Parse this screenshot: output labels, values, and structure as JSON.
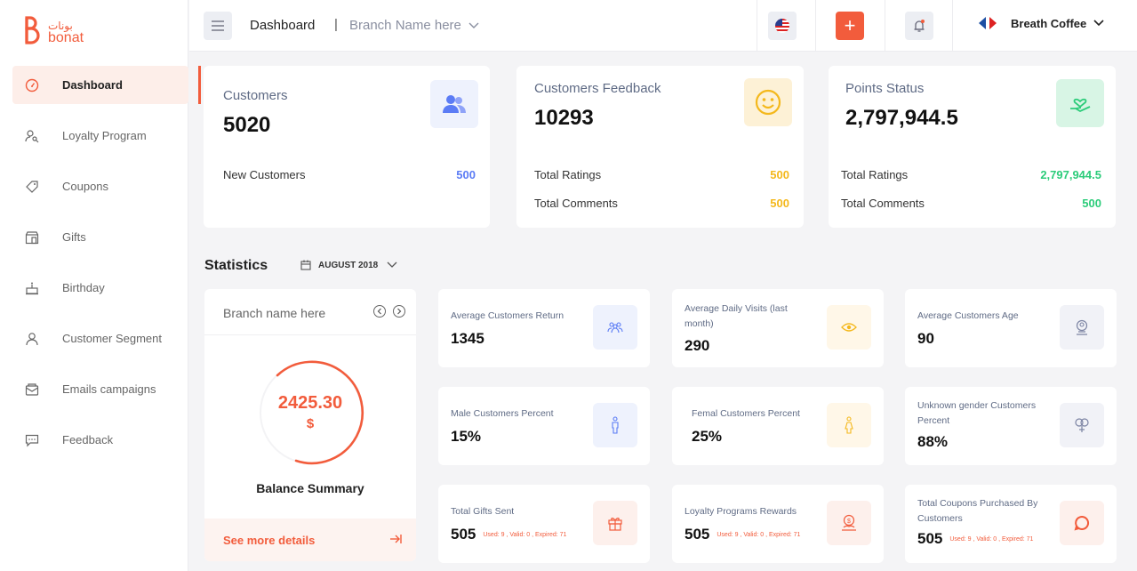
{
  "brand": {
    "name_ar": "بونات",
    "name_en": "bonat",
    "color": "#f25c3c"
  },
  "sidebar": {
    "items": [
      {
        "label": "Dashboard",
        "icon": "gauge-icon",
        "active": true
      },
      {
        "label": "Loyalty Program",
        "icon": "user-key-icon"
      },
      {
        "label": "Coupons",
        "icon": "tag-icon"
      },
      {
        "label": "Gifts",
        "icon": "gift-shop-icon"
      },
      {
        "label": "Birthday",
        "icon": "cake-icon"
      },
      {
        "label": "Customer Segment",
        "icon": "user-icon"
      },
      {
        "label": "Emails campaigns",
        "icon": "mail-icon"
      },
      {
        "label": "Feedback",
        "icon": "chat-icon"
      }
    ]
  },
  "topbar": {
    "title": "Dashboard",
    "separator": "|",
    "branch_placeholder": "Branch Name here",
    "add_label": "+",
    "account_name": "Breath Coffee"
  },
  "summary": {
    "customers": {
      "title": "Customers",
      "value": "5020",
      "rows": [
        {
          "label": "New Customers",
          "value": "500",
          "color": "#5b7cf5"
        }
      ]
    },
    "feedback": {
      "title": "Customers Feedback",
      "value": "10293",
      "rows": [
        {
          "label": "Total Ratings",
          "value": "500",
          "color": "#f4b81c"
        },
        {
          "label": "Total Comments",
          "value": "500",
          "color": "#f4b81c"
        }
      ]
    },
    "points": {
      "title": "Points Status",
      "value": "2,797,944.5",
      "rows": [
        {
          "label": "Total Ratings",
          "value": "2,797,944.5",
          "color": "#2ccc7a"
        },
        {
          "label": "Total Comments",
          "value": "500",
          "color": "#2ccc7a"
        }
      ]
    }
  },
  "statistics": {
    "title": "Statistics",
    "month": "AUGUST 2018",
    "balance": {
      "branch": "Branch name here",
      "amount": "2425.30",
      "currency": "$",
      "label": "Balance Summary",
      "link": "See more details"
    },
    "cards": [
      {
        "label": "Average Customers Return",
        "value": "1345",
        "icon": "group-icon",
        "bg": "#eef2fd",
        "fg": "#5b7cf5"
      },
      {
        "label": "Average Daily Visits (last month)",
        "value": "290",
        "icon": "eye-icon",
        "bg": "#fff7e8",
        "fg": "#f4b81c"
      },
      {
        "label": "Average Customers Age",
        "value": "90",
        "icon": "age-badge-icon",
        "bg": "#f1f2f7",
        "fg": "#7c84a3"
      },
      {
        "label": "Male Customers Percent",
        "value": "15%",
        "icon": "male-icon",
        "bg": "#eef2fd",
        "fg": "#5b7cf5"
      },
      {
        "label": "Femal Customers Percent",
        "value": "25%",
        "icon": "female-icon",
        "bg": "#fff7e8",
        "fg": "#f4b81c"
      },
      {
        "label": "Unknown gender Customers Percent",
        "value": "88%",
        "icon": "gender-unknown-icon",
        "bg": "#f1f2f7",
        "fg": "#7c84a3"
      },
      {
        "label": "Total Gifts Sent",
        "value": "505",
        "sub": "Used: 9 , Valid: 0 , Expired: 71",
        "icon": "gift-icon",
        "bg": "#fdf0ec",
        "fg": "#f25c3c"
      },
      {
        "label": "Loyalty Programs Rewards",
        "value": "505",
        "sub": "Used: 9 , Valid: 0 , Expired: 71",
        "icon": "reward-icon",
        "bg": "#fdf0ec",
        "fg": "#f25c3c"
      },
      {
        "label": "Total Coupons Purchased By Customers",
        "value": "505",
        "sub": "Used: 9 , Valid: 0 , Expired: 71",
        "icon": "coupon-chat-icon",
        "bg": "#fdf0ec",
        "fg": "#f25c3c"
      }
    ]
  }
}
